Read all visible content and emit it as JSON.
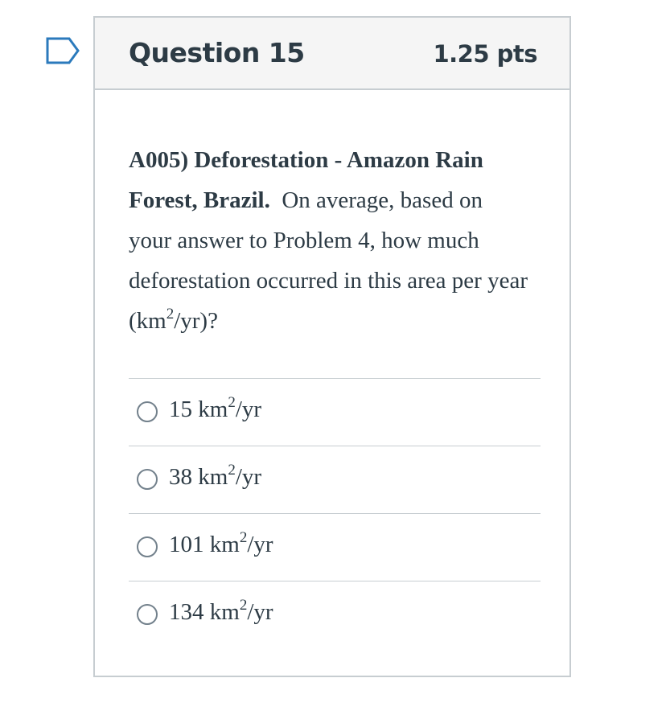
{
  "colors": {
    "flag_outline": "#2b7abc",
    "text": "#2d3b45",
    "header_bg": "#f5f5f5",
    "border": "#c7cdd1",
    "radio_border": "#73818c"
  },
  "icons": {
    "flag": "flag-question-icon",
    "radio": "radio-unselected-icon"
  },
  "question": {
    "title": "Question 15",
    "points": "1.25 pts",
    "code": "A005)",
    "topic": "Deforestation - Amazon Rain Forest, Brazil.",
    "body_start": "On average, based on your answer to Problem 4, how much deforestation occurred in this area per year (km",
    "body_sup": "2",
    "body_end": "/yr)?"
  },
  "answers": [
    {
      "value": "15",
      "unit": "km",
      "sup": "2",
      "suffix": "/yr"
    },
    {
      "value": "38",
      "unit": "km",
      "sup": "2",
      "suffix": "/yr"
    },
    {
      "value": "101",
      "unit": "km",
      "sup": "2",
      "suffix": "/yr"
    },
    {
      "value": "134",
      "unit": "km",
      "sup": "2",
      "suffix": "/yr"
    }
  ]
}
